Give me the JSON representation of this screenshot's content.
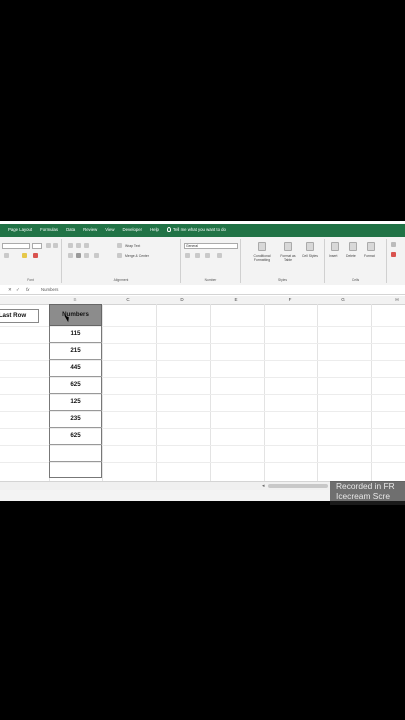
{
  "menubar": {
    "tabs": [
      "Page Layout",
      "Formulas",
      "Data",
      "Review",
      "View",
      "Developer",
      "Help"
    ],
    "tell_me": "Tell me what you want to do"
  },
  "ribbon": {
    "font_group_label": "Font",
    "alignment_group_label": "Alignment",
    "number_group_label": "Number",
    "styles_group_label": "Styles",
    "cells_group_label": "Cells",
    "wrap_text": "Wrap Text",
    "merge_center": "Merge & Center",
    "number_format": "General",
    "conditional_formatting": "Conditional Formatting",
    "format_as_table": "Format as Table",
    "cell_styles": "Cell Styles",
    "insert": "Insert",
    "delete": "Delete",
    "format": "Format"
  },
  "formula_bar": {
    "fx": "fx",
    "content": "Numbers"
  },
  "columns": [
    "B",
    "C",
    "D",
    "E",
    "F",
    "G",
    "H"
  ],
  "sheet": {
    "macro_button": "Last Row",
    "header": "Numbers",
    "values": [
      "115",
      "215",
      "445",
      "625",
      "125",
      "235",
      "625"
    ]
  },
  "watermark": {
    "line1": "Recorded in FR",
    "line2": "Icecream  Scre"
  }
}
